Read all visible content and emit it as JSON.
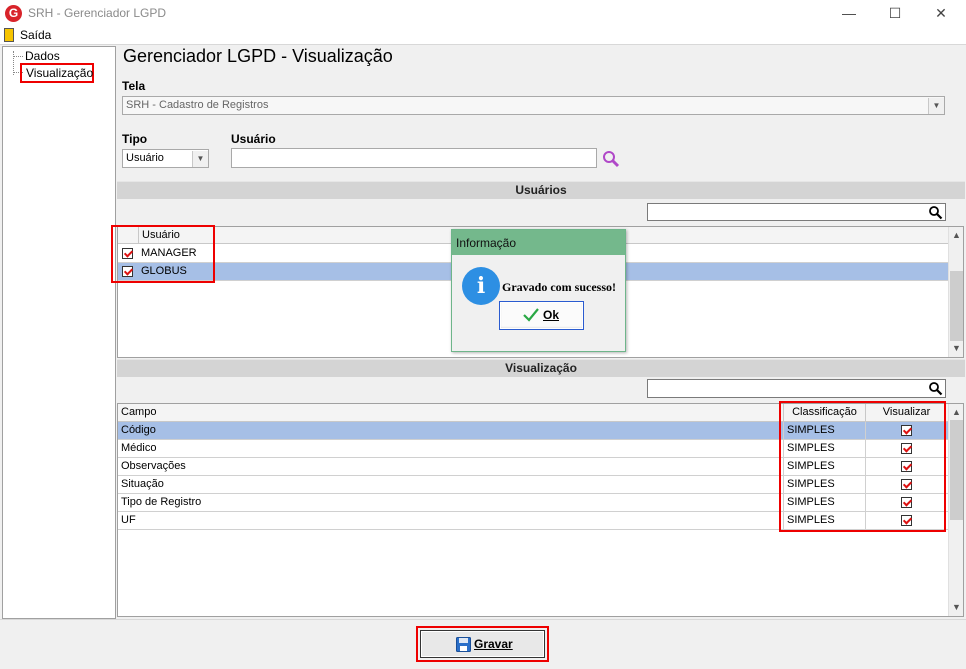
{
  "window": {
    "title": "SRH - Gerenciador LGPD",
    "logo_letter": "G",
    "minimize": "—",
    "maximize": "☐",
    "close": "✕"
  },
  "menu": {
    "exit_label": "Saída"
  },
  "tree": {
    "items": [
      {
        "label": "Dados"
      },
      {
        "label": "Visualização"
      }
    ]
  },
  "page": {
    "title": "Gerenciador LGPD - Visualização"
  },
  "tela": {
    "label": "Tela",
    "value": "SRH - Cadastro de Registros"
  },
  "tipo": {
    "label": "Tipo",
    "value": "Usuário"
  },
  "usuario": {
    "label": "Usuário",
    "value": ""
  },
  "usuarios_section": {
    "title": "Usuários",
    "search_value": "",
    "column": "Usuário",
    "rows": [
      {
        "name": "MANAGER",
        "checked": true,
        "selected": false
      },
      {
        "name": "GLOBUS",
        "checked": true,
        "selected": true
      }
    ]
  },
  "visualizacao_section": {
    "title": "Visualização",
    "search_value": "",
    "columns": {
      "campo": "Campo",
      "classificacao": "Classificação",
      "visualizar": "Visualizar"
    },
    "rows": [
      {
        "campo": "Código",
        "classificacao": "SIMPLES",
        "visualizar": true,
        "selected": true
      },
      {
        "campo": "Médico",
        "classificacao": "SIMPLES",
        "visualizar": true,
        "selected": false
      },
      {
        "campo": "Observações",
        "classificacao": "SIMPLES",
        "visualizar": true,
        "selected": false
      },
      {
        "campo": "Situação",
        "classificacao": "SIMPLES",
        "visualizar": true,
        "selected": false
      },
      {
        "campo": "Tipo de Registro",
        "classificacao": "SIMPLES",
        "visualizar": true,
        "selected": false
      },
      {
        "campo": "UF",
        "classificacao": "SIMPLES",
        "visualizar": true,
        "selected": false
      }
    ]
  },
  "dialog": {
    "title": "Informação",
    "message": "Gravado com sucesso!",
    "ok_label": "Ok",
    "icon": "info-icon"
  },
  "footer": {
    "save_label": "Gravar",
    "save_icon": "floppy-disk-icon"
  },
  "colors": {
    "selection": "#a6bfe6",
    "dialog_title": "#74b88c",
    "highlight_box": "#e00000"
  }
}
